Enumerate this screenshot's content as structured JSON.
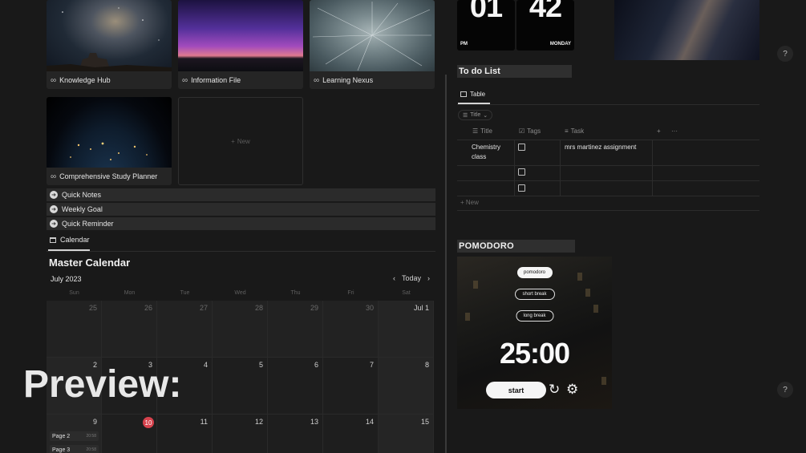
{
  "gallery": [
    {
      "title": "Knowledge Hub"
    },
    {
      "title": "Information File"
    },
    {
      "title": "Learning Nexus"
    },
    {
      "title": "Comprehensive Study Planner"
    }
  ],
  "gallery_new": "New",
  "toggles": [
    "Quick Notes",
    "Weekly Goal",
    "Quick Reminder"
  ],
  "calendar": {
    "tab": "Calendar",
    "title": "Master Calendar",
    "month": "July 2023",
    "today_label": "Today",
    "weekdays": [
      "Sun",
      "Mon",
      "Tue",
      "Wed",
      "Thu",
      "Fri",
      "Sat"
    ],
    "week1": [
      "25",
      "26",
      "27",
      "28",
      "29",
      "30",
      "Jul 1"
    ],
    "week2": [
      "2",
      "3",
      "4",
      "5",
      "6",
      "7",
      "8"
    ],
    "week3": [
      "9",
      "10",
      "11",
      "12",
      "13",
      "14",
      "15"
    ],
    "today": "10",
    "pages": [
      {
        "name": "Page 2",
        "time": "20:58"
      },
      {
        "name": "Page 3",
        "time": "20:58"
      }
    ]
  },
  "clock": {
    "hour": "01",
    "minute": "42",
    "ampm": "PM",
    "day": "MONDAY"
  },
  "todo": {
    "title": "To do List",
    "view_tab": "Table",
    "filter": "Title",
    "columns": [
      "Title",
      "Tags",
      "Task"
    ],
    "rows": [
      {
        "title": "Chemistry class",
        "task": "mrs martinez assignment"
      },
      {
        "title": "",
        "task": ""
      },
      {
        "title": "",
        "task": ""
      }
    ],
    "new_label": "New"
  },
  "pomodoro": {
    "title": "POMODORO",
    "modes": [
      "pomodoro",
      "short break",
      "long break"
    ],
    "timer": "25:00",
    "start_label": "start"
  },
  "help": "?",
  "overlay_text": "Preview:"
}
